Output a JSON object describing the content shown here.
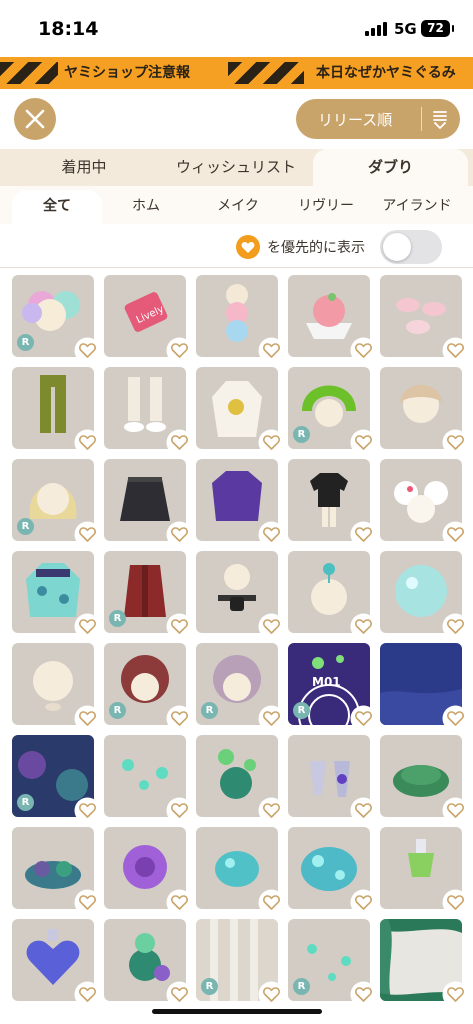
{
  "status_bar": {
    "time": "18:14",
    "network": "5G",
    "battery": "72"
  },
  "banner": {
    "text_1": "ヤミショップ注意報",
    "text_2": "本日なぜかヤミぐるみ"
  },
  "toolbar": {
    "sort_label": "リリース順",
    "close_icon": "close-icon",
    "sort_icon": "sort-order-icon"
  },
  "tabs_main": [
    {
      "label": "着用中"
    },
    {
      "label": "ウィッシュリスト"
    },
    {
      "label": "ダブり"
    }
  ],
  "tabs_sub": [
    {
      "label": "全て"
    },
    {
      "label": "ホム"
    },
    {
      "label": "メイク"
    },
    {
      "label": "リヴリー"
    },
    {
      "label": "アイランド"
    }
  ],
  "filter": {
    "label": "を優先的に表示",
    "toggle_on": false
  },
  "colors": {
    "accent": "#c9a46a",
    "orange": "#f29d1e",
    "tile_bg": "#d2ccc4",
    "r_badge": "#7ab6b1"
  },
  "items": [
    {
      "name": "pastel-pompom-hair",
      "rare": true
    },
    {
      "name": "lively-patch",
      "rare": false
    },
    {
      "name": "ice-cream-tower",
      "rare": false
    },
    {
      "name": "peach-dessert-bowl",
      "rare": false
    },
    {
      "name": "pink-macarons",
      "rare": false
    },
    {
      "name": "olive-pants",
      "rare": false
    },
    {
      "name": "white-socks-sneakers",
      "rare": false
    },
    {
      "name": "white-hoodie",
      "rare": false
    },
    {
      "name": "green-hood",
      "rare": true
    },
    {
      "name": "beige-hairstyle",
      "rare": false
    },
    {
      "name": "blonde-hairstyle",
      "rare": true
    },
    {
      "name": "black-skirt",
      "rare": false
    },
    {
      "name": "purple-jacket",
      "rare": false
    },
    {
      "name": "black-tee",
      "rare": false
    },
    {
      "name": "white-flower-outfit",
      "rare": false
    },
    {
      "name": "teal-spotted-dress",
      "rare": false
    },
    {
      "name": "red-coat",
      "rare": true
    },
    {
      "name": "waist-pouch",
      "rare": false
    },
    {
      "name": "mushroom-sprout",
      "rare": false
    },
    {
      "name": "glow-orb",
      "rare": false
    },
    {
      "name": "blank-face",
      "rare": false
    },
    {
      "name": "red-curly-hair",
      "rare": true
    },
    {
      "name": "lilac-curly-hair",
      "rare": true
    },
    {
      "name": "music-background",
      "rare": true,
      "label": "M01"
    },
    {
      "name": "night-sea-background",
      "rare": false
    },
    {
      "name": "deep-forest-background",
      "rare": true
    },
    {
      "name": "teal-fireflies",
      "rare": false
    },
    {
      "name": "coral-plant",
      "rare": false
    },
    {
      "name": "crystal-bottles",
      "rare": false
    },
    {
      "name": "moss-rock",
      "rare": false
    },
    {
      "name": "sea-grass",
      "rare": false
    },
    {
      "name": "purple-urchin",
      "rare": false
    },
    {
      "name": "teal-bubble-egg",
      "rare": false
    },
    {
      "name": "big-bubble-egg",
      "rare": false
    },
    {
      "name": "green-potion",
      "rare": false
    },
    {
      "name": "heart-potion",
      "rare": false
    },
    {
      "name": "tropical-plant",
      "rare": false
    },
    {
      "name": "light-pillars",
      "rare": true
    },
    {
      "name": "firefly-sparkles",
      "rare": true
    },
    {
      "name": "leaf-frame",
      "rare": false
    }
  ]
}
